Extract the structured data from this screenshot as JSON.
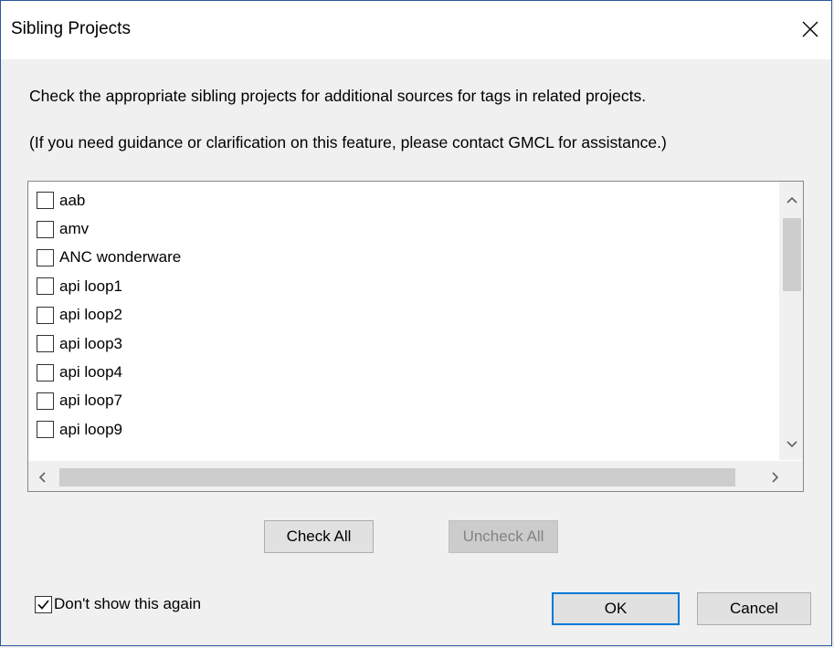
{
  "window": {
    "title": "Sibling Projects"
  },
  "instructions": {
    "line1": "Check the appropriate sibling projects for additional sources for tags in related projects.",
    "line2": "(If you need guidance or clarification on this feature, please contact GMCL for assistance.)"
  },
  "projects": [
    {
      "label": "aab",
      "checked": false
    },
    {
      "label": "amv",
      "checked": false
    },
    {
      "label": "ANC wonderware",
      "checked": false
    },
    {
      "label": "api loop1",
      "checked": false
    },
    {
      "label": "api loop2",
      "checked": false
    },
    {
      "label": "api loop3",
      "checked": false
    },
    {
      "label": "api loop4",
      "checked": false
    },
    {
      "label": "api loop7",
      "checked": false
    },
    {
      "label": "api loop9",
      "checked": false
    }
  ],
  "buttons": {
    "check_all": "Check All",
    "uncheck_all": "Uncheck All",
    "ok": "OK",
    "cancel": "Cancel"
  },
  "dont_show": {
    "label": "Don't show this again",
    "checked": true
  },
  "icons": {
    "close": "close-icon",
    "scroll_up": "chevron-up-icon",
    "scroll_down": "chevron-down-icon",
    "scroll_left": "chevron-left-icon",
    "scroll_right": "chevron-right-icon"
  },
  "colors": {
    "accent": "#0078d7",
    "window_border": "#2b579a",
    "dialog_bg": "#f0f0f0"
  }
}
